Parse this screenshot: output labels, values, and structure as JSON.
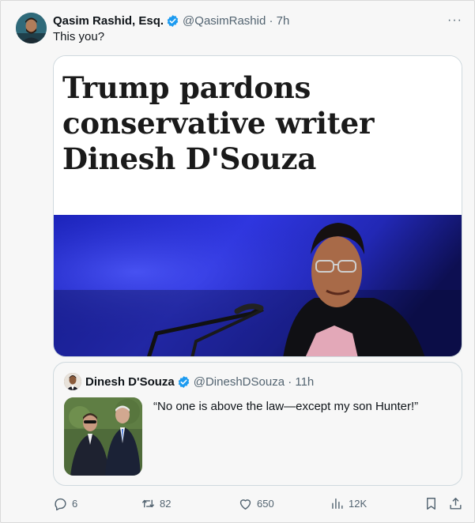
{
  "tweet": {
    "author_name": "Qasim Rashid, Esq.",
    "handle_time": "@QasimRashid · 7h",
    "text": "This you?",
    "more_label": "···"
  },
  "media": {
    "headline": "Trump pardons conservative writer Dinesh D'Souza"
  },
  "quote": {
    "author_name": "Dinesh D'Souza",
    "handle_time": "@DineshDSouza · 11h",
    "text": "“No one is above the law—except my son Hunter!”"
  },
  "actions": {
    "replies": "6",
    "retweets": "82",
    "likes": "650",
    "views": "12K"
  },
  "colors": {
    "verified": "#1d9bf0",
    "secondary_text": "#536471",
    "border": "#cfd9de"
  }
}
